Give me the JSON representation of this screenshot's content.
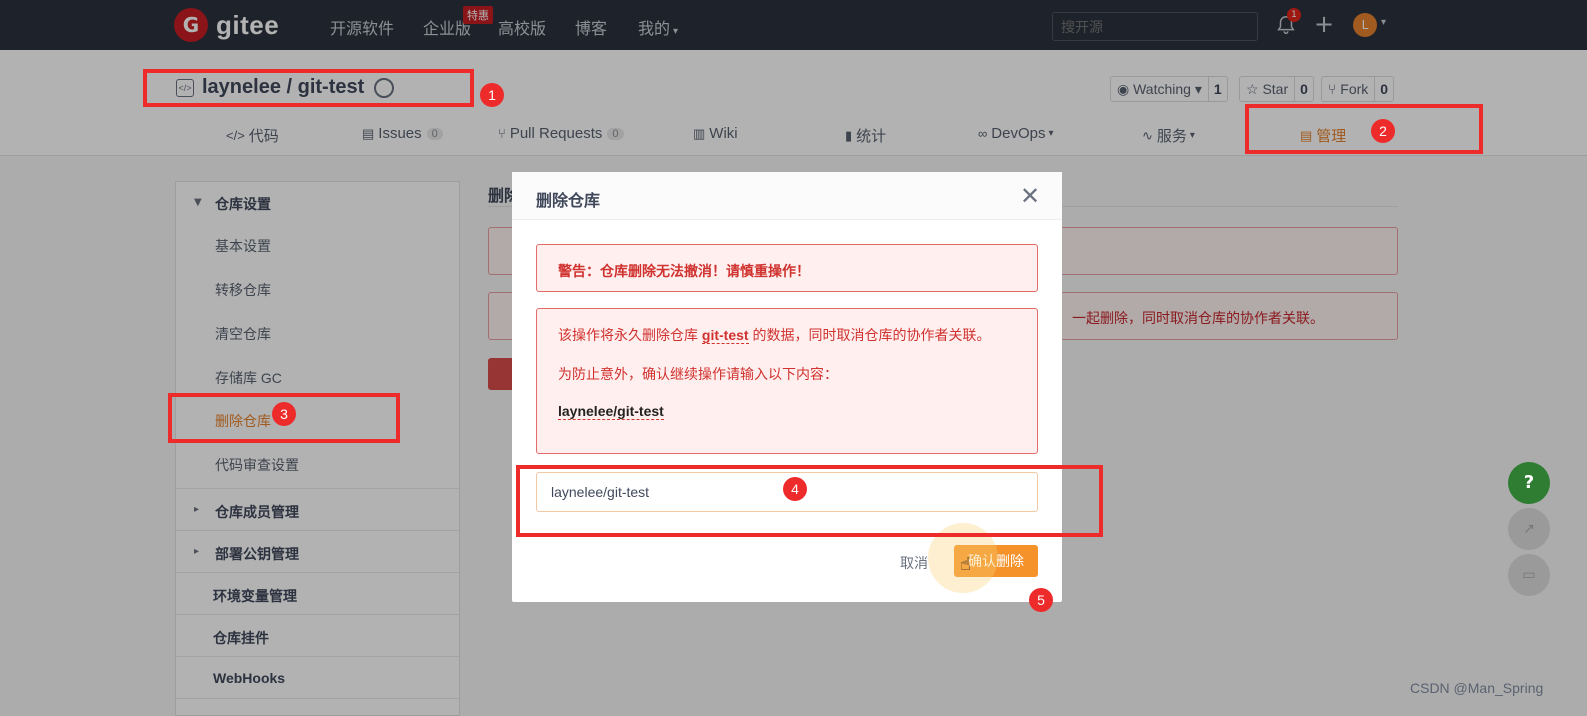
{
  "topnav": {
    "logo_mark": "G",
    "logo_text": "gitee",
    "items": [
      "开源软件",
      "企业版",
      "高校版",
      "博客",
      "我的"
    ],
    "enterprise_badge": "特惠",
    "search_placeholder": "搜开源",
    "notification_count": "1",
    "plus": "+",
    "avatar_letter": "L"
  },
  "repo": {
    "title": "laynelee / git-test",
    "icon_glyph": "</>",
    "watching": {
      "label": "Watching",
      "count": "1"
    },
    "star": {
      "label": "Star",
      "count": "0"
    },
    "fork": {
      "label": "Fork",
      "count": "0"
    }
  },
  "tabs": [
    {
      "label": "代码",
      "icon": "</>"
    },
    {
      "label": "Issues",
      "count": "0",
      "icon": "▤"
    },
    {
      "label": "Pull Requests",
      "count": "0",
      "icon": "⑂"
    },
    {
      "label": "Wiki",
      "icon": "▥"
    },
    {
      "label": "统计",
      "icon": "▮"
    },
    {
      "label": "DevOps",
      "icon": "∞"
    },
    {
      "label": "服务",
      "icon": "∿"
    },
    {
      "label": "管理",
      "icon": "▤"
    }
  ],
  "sidebar": {
    "group_repo_settings": "仓库设置",
    "items": [
      "基本设置",
      "转移仓库",
      "清空仓库",
      "存储库 GC",
      "删除仓库",
      "代码审查设置"
    ],
    "group_members": "仓库成员管理",
    "group_deploy_keys": "部署公钥管理",
    "env_vars": "环境变量管理",
    "widgets": "仓库挂件",
    "webhooks": "WebHooks"
  },
  "content": {
    "title_partial": "删除",
    "alert_partial": "一起删除，同时取消仓库的协作者关联。"
  },
  "modal": {
    "title": "删除仓库",
    "warning": "警告：仓库删除无法撤消！请慎重操作！",
    "info_before": "该操作将永久删除仓库 ",
    "info_repo": "git-test",
    "info_after": " 的数据，同时取消仓库的协作者关联。",
    "prompt": "为防止意外，确认继续操作请输入以下内容：",
    "confirm_text": "laynelee/git-test",
    "input_value": "laynelee/git-test",
    "cancel": "取消",
    "confirm": "确认删除"
  },
  "annotations": [
    "1",
    "2",
    "3",
    "4",
    "5"
  ],
  "floating": {
    "help": "?"
  },
  "watermark": "CSDN @Man_Spring",
  "colors": {
    "accent": "#e7822d",
    "danger": "#d0322f",
    "annotation": "#ee2b2b",
    "nav_bg": "#2b333e"
  }
}
